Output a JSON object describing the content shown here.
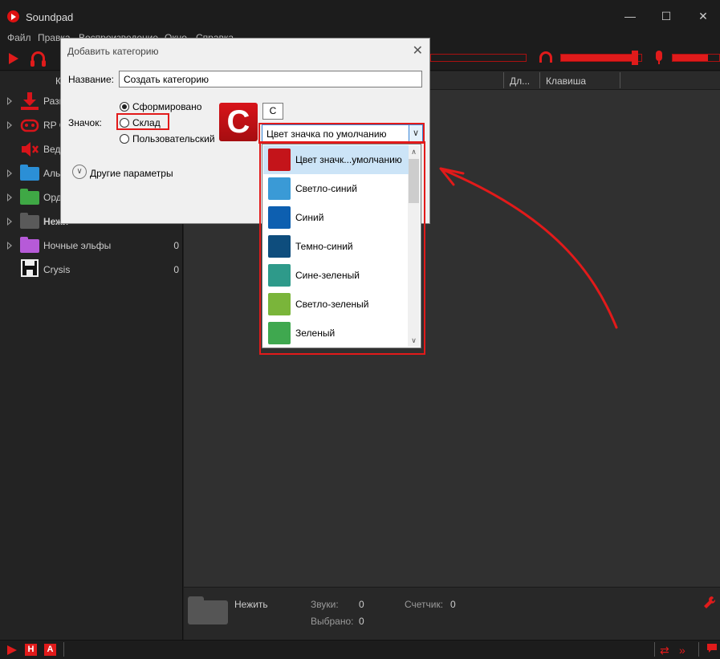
{
  "window": {
    "title": "Soundpad",
    "minimize": "—",
    "maximize": "☐",
    "close": "✕"
  },
  "menu": [
    "Файл",
    "Правка",
    "Воспроизведение",
    "Окно",
    "Справка"
  ],
  "toolbar": {
    "volume_level": 0.92,
    "mic_level": 0.75
  },
  "sidebar": {
    "categories": [
      {
        "label": "Разн",
        "count": "",
        "icon": "download-icon",
        "color": "#d8141a",
        "expandable": true
      },
      {
        "label": "RP C",
        "count": "",
        "icon": "gamepad-icon",
        "color": "#d8141a",
        "expandable": true
      },
      {
        "label": "Веде",
        "count": "",
        "icon": "speaker-icon",
        "color": "#d8141a",
        "expandable": false
      },
      {
        "label": "Аль",
        "count": "",
        "icon": "folder-icon",
        "color": "#2b8fd6",
        "expandable": true
      },
      {
        "label": "Орд",
        "count": "",
        "icon": "folder-icon",
        "color": "#3fa845",
        "expandable": true
      },
      {
        "label": "Нежи",
        "count": "",
        "icon": "folder-icon",
        "color": "#5a5a5a",
        "expandable": true
      },
      {
        "label": "Ночные эльфы",
        "count": "0",
        "icon": "folder-icon",
        "color": "#b65ad8",
        "expandable": true
      },
      {
        "label": "Crysis",
        "count": "0",
        "icon": "floppy-icon",
        "color": "#111111",
        "expandable": false
      }
    ]
  },
  "list_header": {
    "col_k": "К",
    "duration": "Дл...",
    "hotkey": "Клавиша"
  },
  "info": {
    "category": "Нежить",
    "sounds_label": "Звуки:",
    "sounds_value": "0",
    "selected_label": "Выбрано:",
    "selected_value": "0",
    "counter_label": "Счетчик:",
    "counter_value": "0"
  },
  "statusbar": {
    "btn_h": "H",
    "btn_a": "A"
  },
  "dialog": {
    "title": "Добавить категорию",
    "close": "✕",
    "name_label": "Название:",
    "name_value": "Создать категорию",
    "icon_label": "Значок:",
    "radio_generated": "Сформировано",
    "radio_stock": "Склад",
    "radio_custom": "Пользовательский",
    "icon_letter": "C",
    "letter_value": "C",
    "color_selected": "Цвет значка по умолчанию",
    "more_options": "Другие параметры"
  },
  "dropdown": {
    "items": [
      {
        "label": "Цвет значк...умолчанию",
        "color": "#c4141a",
        "selected": true
      },
      {
        "label": "Светло-синий",
        "color": "#3a9ad6",
        "selected": false
      },
      {
        "label": "Синий",
        "color": "#0d5fb0",
        "selected": false
      },
      {
        "label": "Темно-синий",
        "color": "#0e4d7d",
        "selected": false
      },
      {
        "label": "Сине-зеленый",
        "color": "#2e9a8a",
        "selected": false
      },
      {
        "label": "Светло-зеленый",
        "color": "#7ab53a",
        "selected": false
      },
      {
        "label": "Зеленый",
        "color": "#3fa84f",
        "selected": false
      }
    ]
  },
  "colors": {
    "accent": "#e01b1b",
    "annotation": "#e21a1a"
  }
}
